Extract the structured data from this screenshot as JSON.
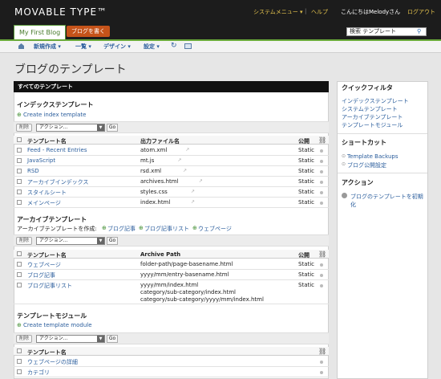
{
  "header": {
    "logo": "MOVABLE TYPE™",
    "system_menu": "システムメニュー ▾",
    "separator": "|",
    "help": "ヘルプ",
    "greeting": "こんにちはMelodyさん",
    "logout": "ログアウト"
  },
  "tabs": {
    "blog": "My First Blog",
    "write": "ブログを書く"
  },
  "search": {
    "value": "検索 テンプレート"
  },
  "nav": {
    "new": "新規作成 ▾",
    "list": "一覧 ▾",
    "design": "デザイン ▾",
    "settings": "設定 ▾"
  },
  "page_title": "ブログのテンプレート",
  "main_header": "すべてのテンプレート",
  "index": {
    "title": "インデックステンプレート",
    "create": "Create index template",
    "delete": "削除",
    "action": "アクション...",
    "go": "Go",
    "col_name": "テンプレート名",
    "col_file": "出力ファイル名",
    "col_pub": "公開",
    "rows": [
      {
        "name": "Feed - Recent Entries",
        "file": "atom.xml",
        "pub": "Static"
      },
      {
        "name": "JavaScript",
        "file": "mt.js",
        "pub": "Static"
      },
      {
        "name": "RSD",
        "file": "rsd.xml",
        "pub": "Static"
      },
      {
        "name": "アーカイブインデックス",
        "file": "archives.html",
        "pub": "Static"
      },
      {
        "name": "スタイルシート",
        "file": "styles.css",
        "pub": "Static"
      },
      {
        "name": "メインページ",
        "file": "index.html",
        "pub": "Static"
      }
    ]
  },
  "archive": {
    "title": "アーカイブテンプレート",
    "create_label": "アーカイブテンプレートを作成:",
    "opt1": "ブログ記事",
    "opt2": "ブログ記事リスト",
    "opt3": "ウェブページ",
    "delete": "削除",
    "action": "アクション...",
    "go": "Go",
    "col_name": "テンプレート名",
    "col_path": "Archive Path",
    "col_pub": "公開",
    "rows": [
      {
        "name": "ウェブページ",
        "path": "folder-path/page-basename.html",
        "pub": "Static"
      },
      {
        "name": "ブログ記事",
        "path": "yyyy/mm/entry-basename.html",
        "pub": "Static"
      },
      {
        "name": "ブログ記事リスト",
        "path1": "yyyy/mm/index.html",
        "path2": "category/sub-category/index.html",
        "path3": "category/sub-category/yyyy/mm/index.html",
        "pub": "Static"
      }
    ]
  },
  "module": {
    "title": "テンプレートモジュール",
    "create": "Create template module",
    "delete": "削除",
    "action": "アクション...",
    "go": "Go",
    "col_name": "テンプレート名",
    "rows": [
      {
        "name": "ウェブページの詳細"
      },
      {
        "name": "カテゴリ"
      }
    ]
  },
  "sidebar": {
    "quick_title": "クイックフィルタ",
    "quick": [
      "インデックステンプレート",
      "システムテンプレート",
      "アーカイブテンプレート",
      "テンプレートモジュール"
    ],
    "shortcut_title": "ショートカット",
    "shortcuts": [
      "Template Backups",
      "ブログ公開設定"
    ],
    "action_title": "アクション",
    "action": "ブログのテンプレートを初期化"
  },
  "colors": {
    "accent": "#2a5d9c",
    "write_tab": "#c5531a",
    "tab_green": "#467a2a"
  }
}
